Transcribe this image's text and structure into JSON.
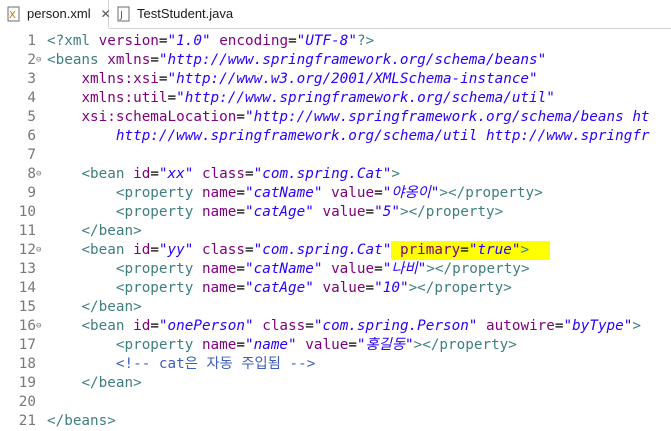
{
  "tabs": [
    {
      "label": "person.xml",
      "icon": "xml-file-icon",
      "active": true,
      "close": "✕"
    },
    {
      "label": "TestStudent.java",
      "icon": "java-file-icon",
      "active": false
    }
  ],
  "editor": {
    "lines": [
      {
        "n": "1",
        "fold": "",
        "tokens": [
          [
            "t",
            "<?"
          ],
          [
            "t",
            "xml"
          ],
          [
            "x",
            " "
          ],
          [
            "a",
            "version"
          ],
          [
            "x",
            "="
          ],
          [
            "v",
            "\"1.0\""
          ],
          [
            "x",
            " "
          ],
          [
            "a",
            "encoding"
          ],
          [
            "x",
            "="
          ],
          [
            "v",
            "\"UTF-8\""
          ],
          [
            "t",
            "?>"
          ]
        ]
      },
      {
        "n": "2",
        "fold": "⊖",
        "tokens": [
          [
            "t",
            "<beans"
          ],
          [
            "x",
            " "
          ],
          [
            "a",
            "xmlns"
          ],
          [
            "x",
            "="
          ],
          [
            "v",
            "\"http://www.springframework.org/schema/beans\""
          ]
        ]
      },
      {
        "n": "3",
        "fold": "",
        "tokens": [
          [
            "x",
            "    "
          ],
          [
            "a",
            "xmlns:xsi"
          ],
          [
            "x",
            "="
          ],
          [
            "v",
            "\"http://www.w3.org/2001/XMLSchema-instance\""
          ]
        ]
      },
      {
        "n": "4",
        "fold": "",
        "tokens": [
          [
            "x",
            "    "
          ],
          [
            "a",
            "xmlns:util"
          ],
          [
            "x",
            "="
          ],
          [
            "v",
            "\"http://www.springframework.org/schema/util\""
          ]
        ]
      },
      {
        "n": "5",
        "fold": "",
        "tokens": [
          [
            "x",
            "    "
          ],
          [
            "a",
            "xsi:schemaLocation"
          ],
          [
            "x",
            "="
          ],
          [
            "v",
            "\"http://www.springframework.org/schema/beans ht"
          ]
        ]
      },
      {
        "n": "6",
        "fold": "",
        "tokens": [
          [
            "x",
            "        "
          ],
          [
            "v",
            "http://www.springframework.org/schema/util http://www.springfr"
          ]
        ]
      },
      {
        "n": "7",
        "fold": "",
        "tokens": []
      },
      {
        "n": "8",
        "fold": "⊖",
        "tokens": [
          [
            "x",
            "    "
          ],
          [
            "t",
            "<bean"
          ],
          [
            "x",
            " "
          ],
          [
            "a",
            "id"
          ],
          [
            "x",
            "="
          ],
          [
            "v",
            "\"xx\""
          ],
          [
            "x",
            " "
          ],
          [
            "a",
            "class"
          ],
          [
            "x",
            "="
          ],
          [
            "v",
            "\"com.spring.Cat\""
          ],
          [
            "t",
            ">"
          ]
        ]
      },
      {
        "n": "9",
        "fold": "",
        "tokens": [
          [
            "x",
            "        "
          ],
          [
            "t",
            "<property"
          ],
          [
            "x",
            " "
          ],
          [
            "a",
            "name"
          ],
          [
            "x",
            "="
          ],
          [
            "v",
            "\"catName\""
          ],
          [
            "x",
            " "
          ],
          [
            "a",
            "value"
          ],
          [
            "x",
            "="
          ],
          [
            "v",
            "\"야옹이\""
          ],
          [
            "t",
            "></property>"
          ]
        ]
      },
      {
        "n": "10",
        "fold": "",
        "tokens": [
          [
            "x",
            "        "
          ],
          [
            "t",
            "<property"
          ],
          [
            "x",
            " "
          ],
          [
            "a",
            "name"
          ],
          [
            "x",
            "="
          ],
          [
            "v",
            "\"catAge\""
          ],
          [
            "x",
            " "
          ],
          [
            "a",
            "value"
          ],
          [
            "x",
            "="
          ],
          [
            "v",
            "\"5\""
          ],
          [
            "t",
            "></property>"
          ]
        ]
      },
      {
        "n": "11",
        "fold": "",
        "tokens": [
          [
            "x",
            "    "
          ],
          [
            "t",
            "</bean>"
          ]
        ]
      },
      {
        "n": "12",
        "fold": "⊖",
        "tokens": [
          [
            "x",
            "    "
          ],
          [
            "t",
            "<bean"
          ],
          [
            "x",
            " "
          ],
          [
            "a",
            "id"
          ],
          [
            "x",
            "="
          ],
          [
            "v",
            "\"yy\""
          ],
          [
            "x",
            " "
          ],
          [
            "a",
            "class"
          ],
          [
            "x",
            "="
          ],
          [
            "v",
            "\"com.spring.Cat\""
          ],
          [
            "x",
            " "
          ],
          [
            "a",
            "primary"
          ],
          [
            "x",
            "="
          ],
          [
            "v",
            "\"true\""
          ],
          [
            "t",
            ">"
          ]
        ]
      },
      {
        "n": "13",
        "fold": "",
        "tokens": [
          [
            "x",
            "        "
          ],
          [
            "t",
            "<property"
          ],
          [
            "x",
            " "
          ],
          [
            "a",
            "name"
          ],
          [
            "x",
            "="
          ],
          [
            "v",
            "\"catName\""
          ],
          [
            "x",
            " "
          ],
          [
            "a",
            "value"
          ],
          [
            "x",
            "="
          ],
          [
            "v",
            "\"나비\""
          ],
          [
            "t",
            "></property>"
          ]
        ]
      },
      {
        "n": "14",
        "fold": "",
        "tokens": [
          [
            "x",
            "        "
          ],
          [
            "t",
            "<property"
          ],
          [
            "x",
            " "
          ],
          [
            "a",
            "name"
          ],
          [
            "x",
            "="
          ],
          [
            "v",
            "\"catAge\""
          ],
          [
            "x",
            " "
          ],
          [
            "a",
            "value"
          ],
          [
            "x",
            "="
          ],
          [
            "v",
            "\"10\""
          ],
          [
            "t",
            "></property>"
          ]
        ]
      },
      {
        "n": "15",
        "fold": "",
        "tokens": [
          [
            "x",
            "    "
          ],
          [
            "t",
            "</bean>"
          ]
        ]
      },
      {
        "n": "16",
        "fold": "⊖",
        "tokens": [
          [
            "x",
            "    "
          ],
          [
            "t",
            "<bean"
          ],
          [
            "x",
            " "
          ],
          [
            "a",
            "id"
          ],
          [
            "x",
            "="
          ],
          [
            "v",
            "\"onePerson\""
          ],
          [
            "x",
            " "
          ],
          [
            "a",
            "class"
          ],
          [
            "x",
            "="
          ],
          [
            "v",
            "\"com.spring.Person\""
          ],
          [
            "x",
            " "
          ],
          [
            "a",
            "autowire"
          ],
          [
            "x",
            "="
          ],
          [
            "v",
            "\"byType\""
          ],
          [
            "t",
            ">"
          ]
        ]
      },
      {
        "n": "17",
        "fold": "",
        "tokens": [
          [
            "x",
            "        "
          ],
          [
            "t",
            "<property"
          ],
          [
            "x",
            " "
          ],
          [
            "a",
            "name"
          ],
          [
            "x",
            "="
          ],
          [
            "v",
            "\"name\""
          ],
          [
            "x",
            " "
          ],
          [
            "a",
            "value"
          ],
          [
            "x",
            "="
          ],
          [
            "v",
            "\"홍길동\""
          ],
          [
            "t",
            "></property>"
          ]
        ]
      },
      {
        "n": "18",
        "fold": "",
        "tokens": [
          [
            "x",
            "        "
          ],
          [
            "c",
            "<!-- cat은 자동 주입됨 -->"
          ]
        ]
      },
      {
        "n": "19",
        "fold": "",
        "tokens": [
          [
            "x",
            "    "
          ],
          [
            "t",
            "</bean>"
          ]
        ]
      },
      {
        "n": "20",
        "fold": "",
        "tokens": []
      },
      {
        "n": "21",
        "fold": "",
        "tokens": [
          [
            "t",
            "</beans>"
          ]
        ]
      }
    ]
  },
  "colors": {
    "tag": "#3f7f7f",
    "attribute": "#7f007f",
    "value": "#2a00ff",
    "comment": "#3f5fbf",
    "highlight": "#ffff00"
  }
}
